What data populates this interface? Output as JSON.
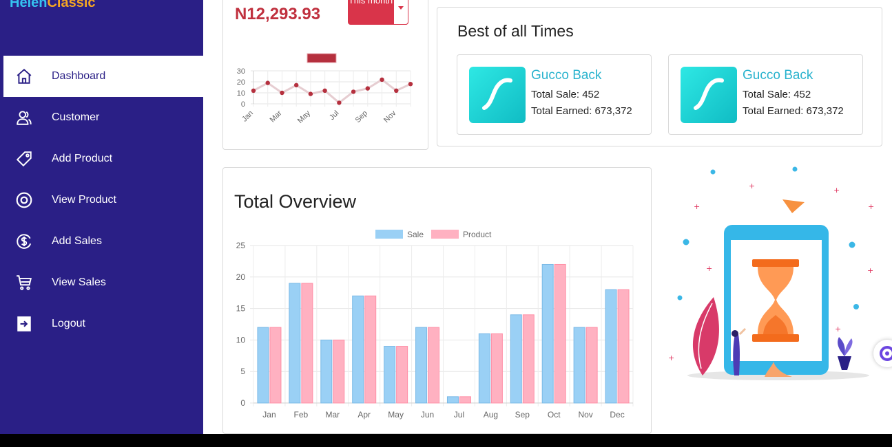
{
  "brand": {
    "part1": "Helen",
    "part2": "Classic"
  },
  "sidebar": {
    "items": [
      {
        "label": "Dashboard",
        "icon": "home-icon"
      },
      {
        "label": "Customer",
        "icon": "users-icon"
      },
      {
        "label": "Add Product",
        "icon": "tag-icon"
      },
      {
        "label": "View Product",
        "icon": "eye-icon"
      },
      {
        "label": "Add Sales",
        "icon": "dollar-circle-icon"
      },
      {
        "label": "View Sales",
        "icon": "cart-icon"
      },
      {
        "label": "Logout",
        "icon": "logout-icon"
      }
    ]
  },
  "revenue": {
    "amount": "N12,293.93",
    "period_label": "This month"
  },
  "best": {
    "title": "Best of all Times",
    "products": [
      {
        "name": "Gucco Back",
        "sale": "Total Sale: 452",
        "earned": "Total Earned: 673,372"
      },
      {
        "name": "Gucco Back",
        "sale": "Total Sale: 452",
        "earned": "Total Earned: 673,372"
      }
    ]
  },
  "overview": {
    "title": "Total Overview"
  },
  "colors": {
    "sidebar": "#2a1f86",
    "accent_red": "#d9344a",
    "sale": "#9ad0f5",
    "product": "#ffb1c1",
    "line": "#b5303e"
  },
  "chart_data": [
    {
      "type": "line",
      "categories": [
        "Jan",
        "Feb",
        "Mar",
        "Apr",
        "May",
        "Jun",
        "Jul",
        "Aug",
        "Sep",
        "Oct",
        "Nov",
        "Dec"
      ],
      "tick_labels": [
        "Jan",
        "Mar",
        "May",
        "Jul",
        "Sep",
        "Nov"
      ],
      "values": [
        12,
        19,
        10,
        17,
        9,
        12,
        1,
        11,
        14,
        22,
        12,
        18
      ],
      "ylim": [
        0,
        30
      ],
      "yticks": [
        0,
        10,
        20,
        30
      ],
      "grid": true,
      "legend": "top-center"
    },
    {
      "type": "bar",
      "categories": [
        "Jan",
        "Feb",
        "Mar",
        "Apr",
        "May",
        "Jun",
        "Jul",
        "Aug",
        "Sep",
        "Oct",
        "Nov",
        "Dec"
      ],
      "series": [
        {
          "name": "Sale",
          "values": [
            12,
            19,
            10,
            17,
            9,
            12,
            1,
            11,
            14,
            22,
            12,
            18
          ]
        },
        {
          "name": "Product",
          "values": [
            12,
            19,
            10,
            17,
            9,
            12,
            1,
            11,
            14,
            22,
            12,
            18
          ]
        }
      ],
      "ylim": [
        0,
        25
      ],
      "yticks": [
        0,
        5,
        10,
        15,
        20,
        25
      ],
      "grid": true,
      "legend": "top-center"
    }
  ]
}
